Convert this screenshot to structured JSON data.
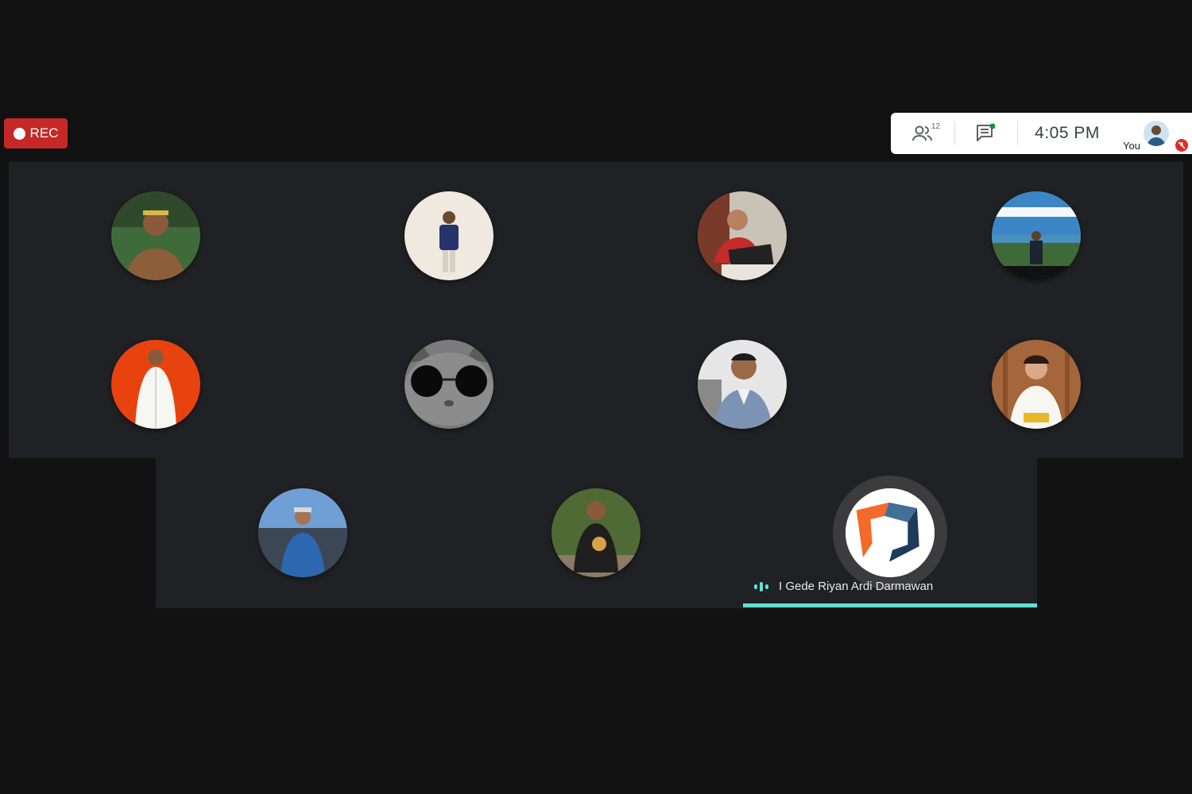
{
  "recording": {
    "label": "REC",
    "color": "#c62828"
  },
  "info_bar": {
    "participant_count": "12",
    "people_icon": "people-icon",
    "chat_icon": "chat-icon",
    "time": "4:05  PM",
    "self_label": "You",
    "mic_status": "muted"
  },
  "participants": [
    {
      "name": "",
      "icon": "participant-1-avatar"
    },
    {
      "name": "",
      "icon": "participant-2-avatar"
    },
    {
      "name": "",
      "icon": "participant-3-avatar"
    },
    {
      "name": "",
      "icon": "participant-4-avatar"
    },
    {
      "name": "",
      "icon": "participant-5-avatar"
    },
    {
      "name": "",
      "icon": "participant-6-avatar"
    },
    {
      "name": "",
      "icon": "participant-7-avatar"
    },
    {
      "name": "",
      "icon": "participant-8-avatar"
    },
    {
      "name": "",
      "icon": "participant-9-avatar"
    },
    {
      "name": "",
      "icon": "participant-10-avatar"
    }
  ],
  "active_speaker": {
    "name": "I Gede Riyan Ardi Darmawan",
    "icon": "speaking-indicator-icon",
    "accent": "#5ee2d0"
  }
}
